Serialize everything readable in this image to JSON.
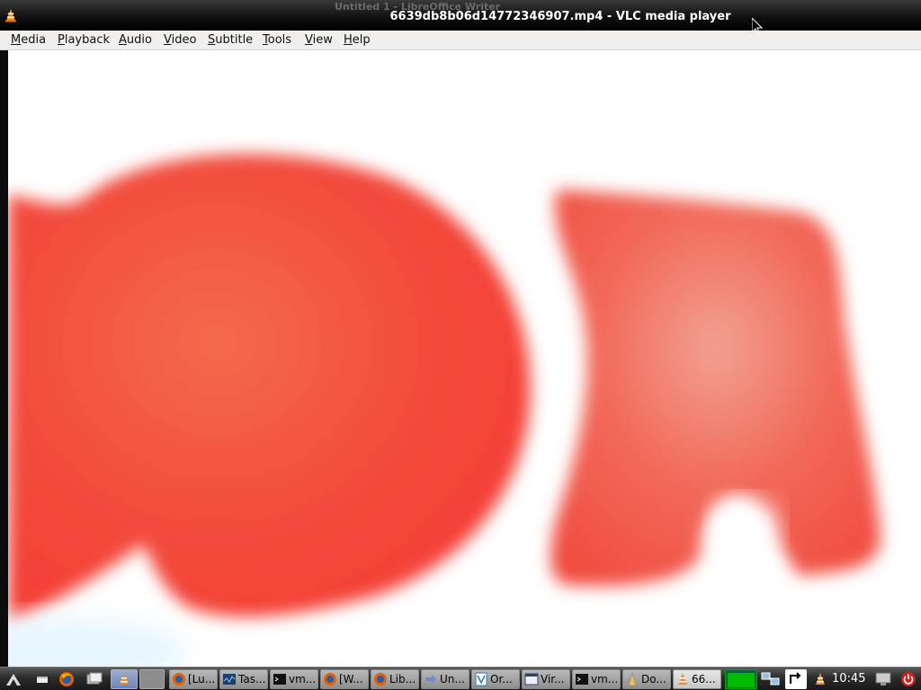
{
  "window": {
    "background_title": "Untitled 1 - LibreOffice Writer",
    "title": "6639db8b06d14772346907.mp4 - VLC media player"
  },
  "menu": {
    "items": [
      "Media",
      "Playback",
      "Audio",
      "Video",
      "Subtitle",
      "Tools",
      "View",
      "Help"
    ]
  },
  "video": {
    "description": "Blurred close-up frame: large red rounded shapes on white background",
    "colors": {
      "red": "#f24a3c",
      "background": "#ffffff"
    }
  },
  "taskbar": {
    "launchers": [
      "start-menu-icon",
      "show-desktop-icon",
      "firefox-icon",
      "file-manager-icon",
      "vlc-icon",
      "blank-app-icon"
    ],
    "tasks": [
      {
        "label": "[Lu...",
        "icon": "firefox-icon"
      },
      {
        "label": "Tas...",
        "icon": "task-manager-icon"
      },
      {
        "label": "vm...",
        "icon": "terminal-icon"
      },
      {
        "label": "[W...",
        "icon": "firefox-icon"
      },
      {
        "label": "Lib...",
        "icon": "firefox-icon"
      },
      {
        "label": "Un...",
        "icon": "arrow-icon"
      },
      {
        "label": "Or...",
        "icon": "libreoffice-icon"
      },
      {
        "label": "Vir...",
        "icon": "window-icon"
      },
      {
        "label": "vm...",
        "icon": "terminal-icon"
      },
      {
        "label": "Do...",
        "icon": "document-icon"
      },
      {
        "label": "66...",
        "icon": "vlc-icon"
      }
    ],
    "tray": [
      "cpu-monitor",
      "network-icon",
      "switch-user-icon",
      "vlc-tray-icon"
    ],
    "clock": "10:45",
    "extra_icons": [
      "monitor-icon",
      "power-icon"
    ]
  }
}
